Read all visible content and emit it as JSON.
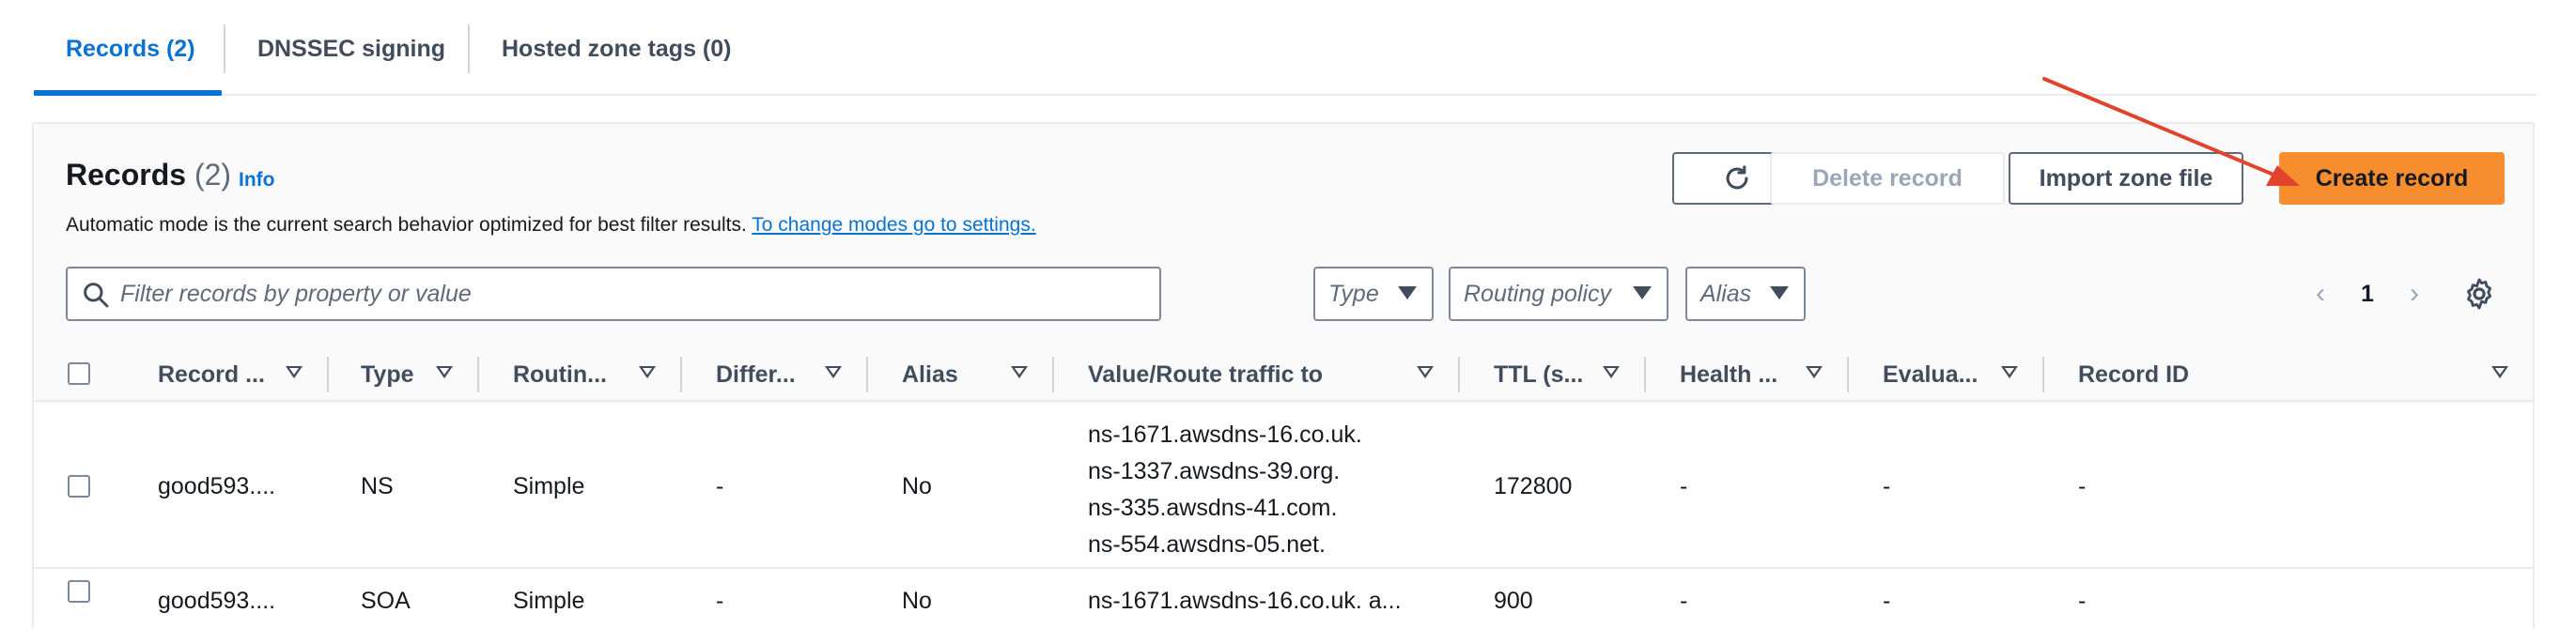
{
  "tabs": [
    {
      "label": "Records (2)",
      "active": true
    },
    {
      "label": "DNSSEC signing",
      "active": false
    },
    {
      "label": "Hosted zone tags (0)",
      "active": false
    }
  ],
  "header": {
    "title": "Records",
    "count": "(2)",
    "info": "Info",
    "description": "Automatic mode is the current search behavior optimized for best filter results.",
    "description_link": "To change modes go to settings."
  },
  "buttons": {
    "refresh_icon": "refresh-icon",
    "delete": "Delete record",
    "import": "Import zone file",
    "create": "Create record"
  },
  "search": {
    "placeholder": "Filter records by property or value"
  },
  "filters": {
    "type": "Type",
    "routing": "Routing policy",
    "alias": "Alias"
  },
  "pagination": {
    "page": "1"
  },
  "table": {
    "columns": [
      "Record ...",
      "Type",
      "Routin...",
      "Differ...",
      "Alias",
      "Value/Route traffic to",
      "TTL (s...",
      "Health ...",
      "Evalua...",
      "Record ID"
    ],
    "rows": [
      {
        "record_name": "good593....",
        "type": "NS",
        "routing": "Simple",
        "differentiator": "-",
        "alias": "No",
        "values": [
          "ns-1671.awsdns-16.co.uk.",
          "ns-1337.awsdns-39.org.",
          "ns-335.awsdns-41.com.",
          "ns-554.awsdns-05.net."
        ],
        "ttl": "172800",
        "health": "-",
        "evaluate": "-",
        "record_id": "-"
      },
      {
        "record_name": "good593....",
        "type": "SOA",
        "routing": "Simple",
        "differentiator": "-",
        "alias": "No",
        "values": [
          "ns-1671.awsdns-16.co.uk. a..."
        ],
        "ttl": "900",
        "health": "-",
        "evaluate": "-",
        "record_id": "-"
      }
    ]
  },
  "colors": {
    "accent": "#0972d3",
    "primary_button": "#f68d2e",
    "annotation_arrow": "#e0442c"
  }
}
